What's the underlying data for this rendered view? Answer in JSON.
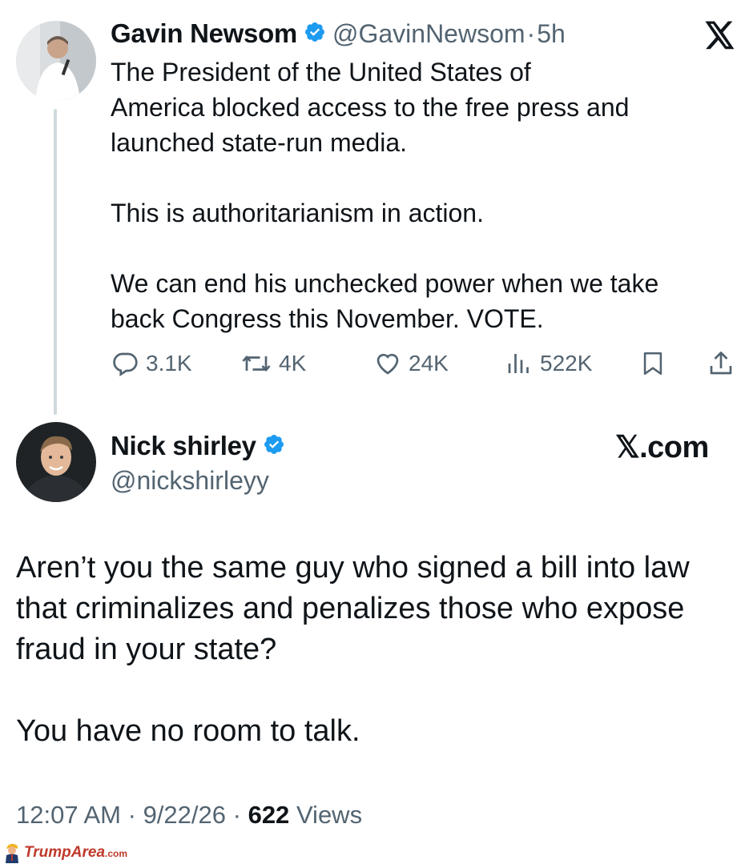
{
  "tweet": {
    "author_name": "Gavin Newsom",
    "author_handle": "@GavinNewsom",
    "separator": "·",
    "time_ago": "5h",
    "platform_logo": "x-logo-icon",
    "paragraphs": [
      "The President of the United States of America blocked access to the free press and launched state-run media.",
      "This is authoritarianism in action.",
      "We can end his unchecked power when we take back Congress this November. VOTE."
    ],
    "line_breaks": {
      "p0": [
        "The President of the United States of",
        "America blocked access to the free press and",
        "launched state-run media."
      ],
      "p2": [
        "We can end his unchecked power when we take",
        "back Congress this November. VOTE."
      ]
    },
    "actions": {
      "replies": "3.1K",
      "reposts": "4K",
      "likes": "24K",
      "views": "522K"
    }
  },
  "reply": {
    "author_name": "Nick shirley",
    "author_handle": "@nickshirleyy",
    "site_label": "𝕏.com",
    "paragraphs": [
      "Aren’t you the same guy who signed a bill into law that criminalizes and penalizes those who expose fraud in your state?",
      "You have no room to talk."
    ],
    "line_breaks": {
      "p0": [
        "Aren’t you the same guy who signed a bill into law",
        "that criminalizes and penalizes those who expose",
        "fraud in your state?"
      ]
    },
    "timestamp": "12:07 AM",
    "date": "9/22/26",
    "views_count": "622",
    "views_label": "Views"
  },
  "watermark": {
    "brand": "TrumpArea",
    "tld": ".com"
  },
  "colors": {
    "verified_blue": "#1d9bf0",
    "text_primary": "#0f1419",
    "text_secondary": "#536471",
    "thread_line": "#cfd9de",
    "watermark_red": "#c0392b"
  }
}
